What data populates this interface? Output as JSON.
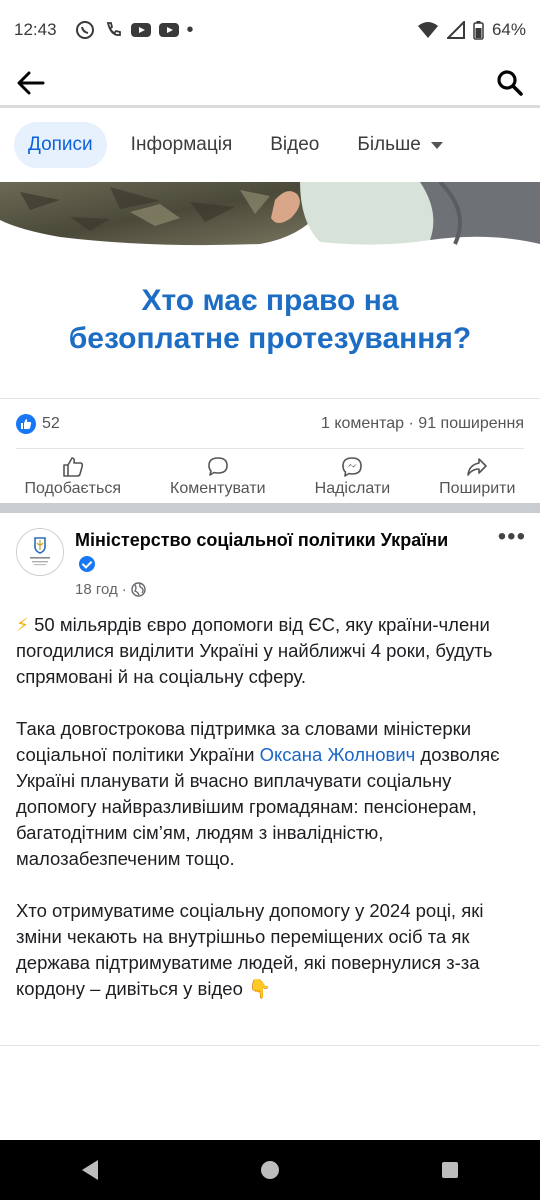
{
  "status_bar": {
    "time": "12:43",
    "battery": "64%",
    "icons": [
      "viber-icon",
      "phone-icon",
      "youtube-icon",
      "youtube-icon",
      "dot-icon",
      "wifi-icon",
      "signal-icon",
      "battery-icon"
    ]
  },
  "app_bar": {
    "back_icon": "back-arrow-icon",
    "search_icon": "search-icon"
  },
  "tabs": [
    {
      "label": "Дописи",
      "active": true
    },
    {
      "label": "Інформація",
      "active": false
    },
    {
      "label": "Відео",
      "active": false
    },
    {
      "label": "Більше",
      "active": false
    }
  ],
  "banner": {
    "title_line1": "Хто має право на",
    "title_line2": "безоплатне протезування?"
  },
  "stats": {
    "likes": "52",
    "summary": "1 коментар · 91 поширення"
  },
  "actions": {
    "like": "Подобається",
    "comment": "Коментувати",
    "send": "Надіслати",
    "share": "Поширити"
  },
  "post": {
    "author": "Міністерство соціальної політики України",
    "time": "18 год",
    "separator": "·",
    "paragraph1_emoji": "⚡",
    "paragraph1": " 50 мільярдів євро допомоги від ЄС, яку країни-члени погодилися виділити Україні у найближчі 4 роки, будуть спрямовані й на соціальну сферу.",
    "paragraph2_pre": "Така довгострокова підтримка за словами міністерки соціальної політики України ",
    "paragraph2_link": "Оксана Жолнович",
    "paragraph2_post": " дозволяє Україні планувати й вчасно виплачувати соціальну допомогу найвразливішим громадянам: пенсіонерам, багатодітним сім’ям, людям з інвалідністю, малозабезпеченим тощо.",
    "paragraph3": "Хто отримуватиме соціальну допомогу у 2024 році, які зміни чекають на внутрішньо переміщених осіб та як держава підтримуватиме людей, які повернулися з-за кордону – дивіться у відео ",
    "paragraph3_emoji": "👇"
  },
  "colors": {
    "accent": "#1877f2",
    "banner_title": "#1c6dc3",
    "link": "#1b66c9",
    "tab_active_bg": "#e7f0fd"
  }
}
